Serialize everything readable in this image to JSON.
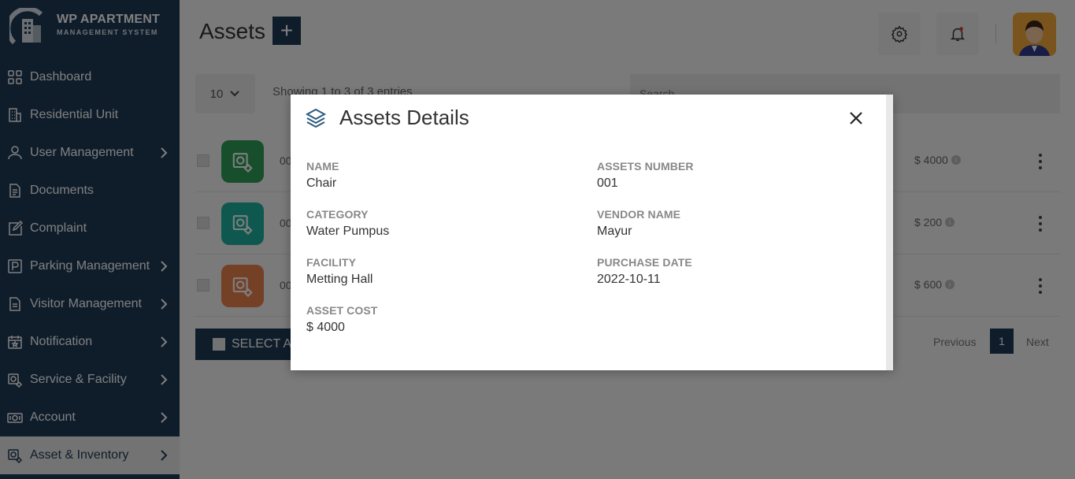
{
  "brand": {
    "title": "WP APARTMENT",
    "subtitle": "MANAGEMENT SYSTEM"
  },
  "sidebar": {
    "items": [
      {
        "label": "Dashboard",
        "icon": "grid-icon",
        "has_chevron": false
      },
      {
        "label": "Residential Unit",
        "icon": "building-icon",
        "has_chevron": false
      },
      {
        "label": "User Management",
        "icon": "user-icon",
        "has_chevron": true
      },
      {
        "label": "Documents",
        "icon": "document-icon",
        "has_chevron": false
      },
      {
        "label": "Complaint",
        "icon": "edit-icon",
        "has_chevron": false
      },
      {
        "label": "Parking Management",
        "icon": "parking-icon",
        "has_chevron": true
      },
      {
        "label": "Visitor Management",
        "icon": "visitor-icon",
        "has_chevron": true
      },
      {
        "label": "Notification",
        "icon": "calendar-icon",
        "has_chevron": true
      },
      {
        "label": "Service & Facility",
        "icon": "service-icon",
        "has_chevron": true
      },
      {
        "label": "Account",
        "icon": "money-icon",
        "has_chevron": true
      },
      {
        "label": "Asset & Inventory",
        "icon": "asset-icon",
        "has_chevron": true,
        "active": true
      }
    ]
  },
  "header": {
    "title": "Assets",
    "add_label": "+"
  },
  "list": {
    "length_value": "10",
    "showing_text": "Showing 1 to 3 of 3 entries",
    "search_placeholder": "Search...",
    "rows": [
      {
        "num": "00",
        "cost": "$ 4000",
        "thumb_color": "#2e9e58"
      },
      {
        "num": "00",
        "cost": "$ 200",
        "thumb_color": "#1cb0a0"
      },
      {
        "num": "00",
        "cost": "$ 600",
        "thumb_color": "#e8834f"
      }
    ],
    "select_all_label": "SELECT ALL",
    "pager": {
      "prev": "Previous",
      "current": "1",
      "next": "Next"
    }
  },
  "modal": {
    "title": "Assets Details",
    "fields": {
      "name": {
        "label": "NAME",
        "value": "Chair"
      },
      "assets_number": {
        "label": "ASSETS NUMBER",
        "value": "001"
      },
      "category": {
        "label": "CATEGORY",
        "value": "Water Pumpus"
      },
      "vendor_name": {
        "label": "VENDOR NAME",
        "value": "Mayur"
      },
      "facility": {
        "label": "FACILITY",
        "value": "Metting Hall"
      },
      "purchase_date": {
        "label": "PURCHASE DATE",
        "value": "2022-10-11"
      },
      "asset_cost": {
        "label": "ASSET COST",
        "value": "$ 4000"
      }
    }
  },
  "colors": {
    "sidebar_bg": "#1f3a57",
    "accent": "#1f3a57"
  }
}
